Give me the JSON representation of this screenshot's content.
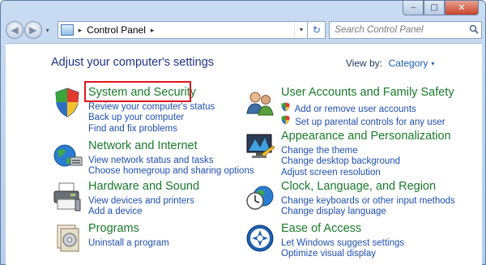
{
  "window": {
    "caption_buttons": {
      "minimize": "‒",
      "maximize": "□",
      "close": "✕"
    }
  },
  "navbar": {
    "back_glyph": "◀",
    "forward_glyph": "▶",
    "recent_glyph": "▾",
    "breadcrumb": [
      "Control Panel"
    ],
    "breadcrumb_sep": "▸",
    "address_drop_glyph": "▾",
    "refresh_glyph": "↻",
    "search_placeholder": "Search Control Panel",
    "search_icon": "search-icon"
  },
  "main": {
    "heading": "Adjust your computer's settings",
    "view_by_label": "View by:",
    "view_by_value": "Category",
    "view_by_arrow": "▾",
    "left_column": [
      {
        "title": "System and Security",
        "icon": "shield-icon",
        "links": [
          "Review your computer's status",
          "Back up your computer",
          "Find and fix problems"
        ]
      },
      {
        "title": "Network and Internet",
        "icon": "globe-network-icon",
        "links": [
          "View network status and tasks",
          "Choose homegroup and sharing options"
        ]
      },
      {
        "title": "Hardware and Sound",
        "icon": "printer-icon",
        "links": [
          "View devices and printers",
          "Add a device"
        ]
      },
      {
        "title": "Programs",
        "icon": "programs-icon",
        "links": [
          "Uninstall a program"
        ]
      }
    ],
    "right_column": [
      {
        "title": "User Accounts and Family Safety",
        "icon": "users-icon",
        "links": [
          "Add or remove user accounts",
          "Set up parental controls for any user"
        ]
      },
      {
        "title": "Appearance and Personalization",
        "icon": "monitor-icon",
        "links": [
          "Change the theme",
          "Change desktop background",
          "Adjust screen resolution"
        ]
      },
      {
        "title": "Clock, Language, and Region",
        "icon": "clock-globe-icon",
        "links": [
          "Change keyboards or other input methods",
          "Change display language"
        ]
      },
      {
        "title": "Ease of Access",
        "icon": "ease-of-access-icon",
        "links": [
          "Let Windows suggest settings",
          "Optimize visual display"
        ]
      }
    ]
  },
  "colors": {
    "category_title": "#1a7a2b",
    "link": "#1e4fb0",
    "heading": "#1e3287",
    "highlight_border": "#e0141b"
  }
}
